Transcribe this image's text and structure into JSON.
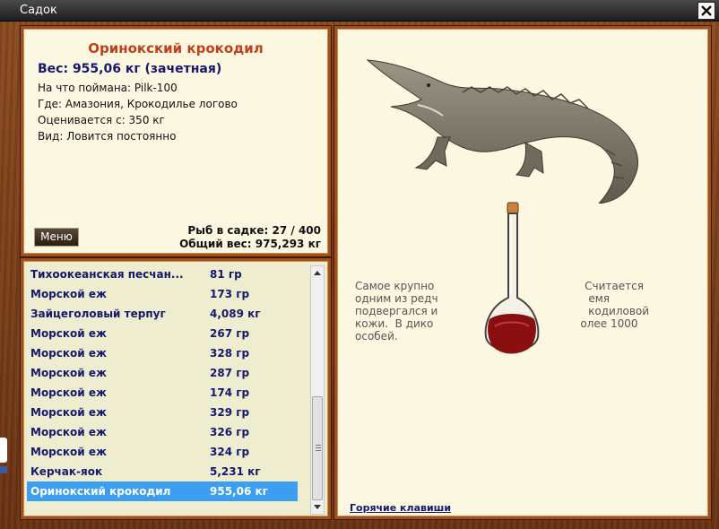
{
  "window": {
    "title": "Садок"
  },
  "info": {
    "fish_name": "Оринокский крокодил",
    "weight_line": "Вес: 955,06 кг (зачетная)",
    "attributes": [
      {
        "label": "На что поймана:",
        "value": "Pilk-100"
      },
      {
        "label": "Где:",
        "value": "Амазония, Крокодилье логово"
      },
      {
        "label": "Оценивается с:",
        "value": "350 кг"
      },
      {
        "label": "Вид:",
        "value": "Ловится постоянно"
      }
    ],
    "menu_label": "Меню",
    "count_label": "Рыб в садке: 27 / 400",
    "total_label": "Общий вес: 975,293 кг"
  },
  "list": {
    "rows": [
      {
        "name": "Тихоокеанская песчан...",
        "weight": "81 гр"
      },
      {
        "name": "Морской еж",
        "weight": "173 гр"
      },
      {
        "name": "Зайцеголовый терпуг",
        "weight": "4,089 кг"
      },
      {
        "name": "Морской еж",
        "weight": "267 гр"
      },
      {
        "name": "Морской еж",
        "weight": "328 гр"
      },
      {
        "name": "Морской еж",
        "weight": "287 гр"
      },
      {
        "name": "Морской еж",
        "weight": "174 гр"
      },
      {
        "name": "Морской еж",
        "weight": "329 гр"
      },
      {
        "name": "Морской еж",
        "weight": "326 гр"
      },
      {
        "name": "Морской еж",
        "weight": "324 гр"
      },
      {
        "name": "Керчак-яок",
        "weight": "5,231 кг"
      },
      {
        "name": "Оринокский крокодил",
        "weight": "955,06 кг"
      }
    ],
    "selected_index": 11
  },
  "detail": {
    "description_lines": [
      "Самое крупно                                            Считается",
      "одним из редч                                            емя",
      "подвергался и                                            кодиловой",
      "кожи.  В дико                                           олее 1000",
      "особей."
    ],
    "hotkeys_label": "Горячие клавиши"
  },
  "icons": {
    "close": "close-icon",
    "scroll_up": "arrow-up-icon",
    "scroll_down": "arrow-down-icon",
    "flask": "flask-icon",
    "crocodile": "crocodile-image"
  },
  "colors": {
    "selected_row": "#3b9ef0",
    "row_text": "#14186e",
    "fish_name": "#c0401a",
    "panel_border": "#a0501c"
  }
}
